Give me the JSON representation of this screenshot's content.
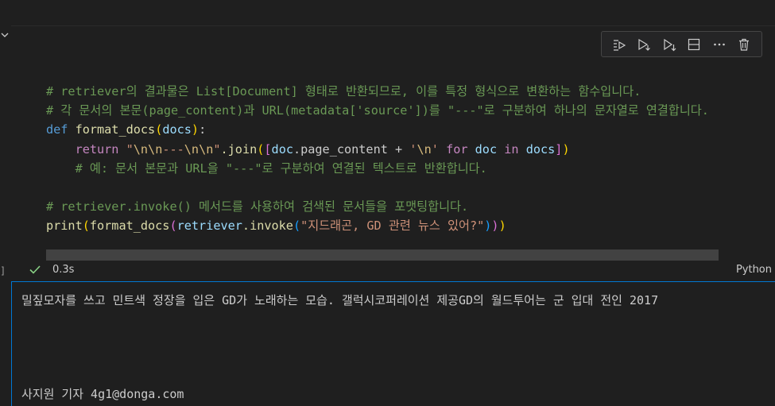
{
  "toolbar": {
    "buttons": [
      {
        "icon": "execute-above-icon",
        "title": "Execute Above Cells"
      },
      {
        "icon": "execute-below-icon",
        "title": "Execute Cell and Below"
      },
      {
        "icon": "run-below-icon",
        "title": "Execute Below"
      },
      {
        "icon": "split-cell-icon",
        "title": "Split Cell"
      },
      {
        "icon": "more-icon",
        "title": "More Actions"
      },
      {
        "icon": "trash-icon",
        "title": "Delete Cell"
      }
    ]
  },
  "code": {
    "line1": "# retriever의 결과물은 List[Document] 형태로 반환되므로, 이를 특정 형식으로 변환하는 함수입니다.",
    "line2": "# 각 문서의 본문(page_content)과 URL(metadata['source'])를 \"---\"로 구분하여 하나의 문자열로 연결합니다.",
    "kw_def": "def",
    "fn_name": "format_docs",
    "param_docs": "docs",
    "kw_return": "return",
    "str_sep_start": "\"",
    "str_sep_escape1": "\\n\\n",
    "str_sep_mid": "---",
    "str_sep_escape2": "\\n\\n",
    "str_sep_end": "\"",
    "join_call": ".join",
    "var_doc": "doc",
    "attr_page": ".page_content + ",
    "str_nl_q1": "'",
    "str_nl_escape": "\\n",
    "str_nl_q2": "'",
    "kw_for": "for",
    "var_doc2": "doc",
    "kw_in": "in",
    "var_docs2": "docs",
    "line5": "# 예: 문서 본문과 URL을 \"---\"로 구분하여 연결된 텍스트로 반환합니다.",
    "line7": "# retriever.invoke() 메서드를 사용하여 검색된 문서들을 포맷팅합니다.",
    "fn_print": "print",
    "fn_format2": "format_docs",
    "var_retriever": "retriever",
    "fn_invoke": ".invoke",
    "str_query": "\"지드래곤, GD 관련 뉴스 있어?\""
  },
  "status": {
    "time": "0.3s",
    "language": "Python"
  },
  "output": {
    "line1": "밀짚모자를 쓰고 민트색 정장을 입은 GD가 노래하는 모습. 갤럭시코퍼레이션 제공GD의 월드투어는 군 입대 전인 2017",
    "line2": "사지원 기자 4g1@donga.com"
  }
}
